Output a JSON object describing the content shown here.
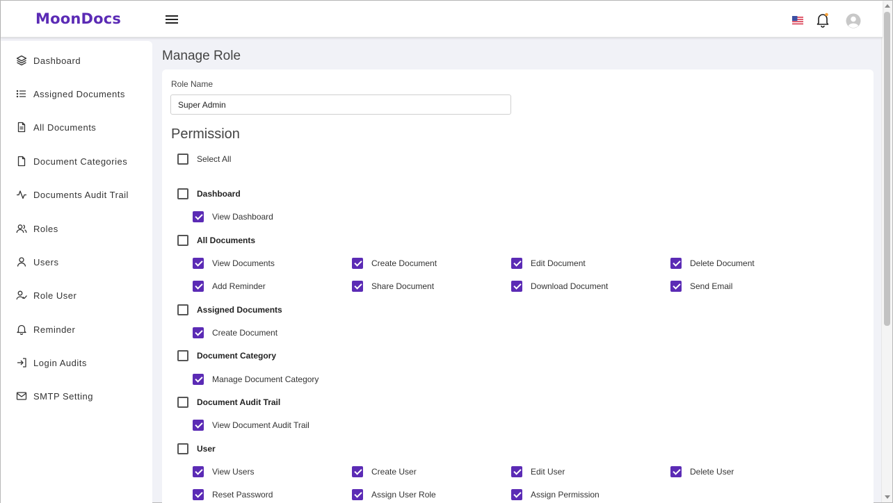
{
  "header": {
    "logo": "MoonDocs"
  },
  "sidebar": {
    "items": [
      {
        "label": "Dashboard",
        "icon": "layers-icon"
      },
      {
        "label": "Assigned Documents",
        "icon": "list-icon"
      },
      {
        "label": "All Documents",
        "icon": "file-text-icon"
      },
      {
        "label": "Document Categories",
        "icon": "file-icon"
      },
      {
        "label": "Documents Audit Trail",
        "icon": "activity-icon"
      },
      {
        "label": "Roles",
        "icon": "users-icon"
      },
      {
        "label": "Users",
        "icon": "user-icon"
      },
      {
        "label": "Role User",
        "icon": "user-check-icon"
      },
      {
        "label": "Reminder",
        "icon": "bell-icon"
      },
      {
        "label": "Login Audits",
        "icon": "log-in-icon"
      },
      {
        "label": "SMTP Setting",
        "icon": "mail-icon"
      }
    ]
  },
  "main": {
    "title": "Manage Role",
    "role_name_label": "Role Name",
    "role_name_value": "Super Admin",
    "permission_title": "Permission",
    "select_all": "Select All",
    "groups": [
      {
        "name": "Dashboard",
        "permissions": [
          "View Dashboard"
        ]
      },
      {
        "name": "All Documents",
        "permissions": [
          "View Documents",
          "Create Document",
          "Edit Document",
          "Delete Document",
          "Add Reminder",
          "Share Document",
          "Download Document",
          "Send Email"
        ]
      },
      {
        "name": "Assigned Documents",
        "permissions": [
          "Create Document"
        ]
      },
      {
        "name": "Document Category",
        "permissions": [
          "Manage Document Category"
        ]
      },
      {
        "name": "Document Audit Trail",
        "permissions": [
          "View Document Audit Trail"
        ]
      },
      {
        "name": "User",
        "permissions": [
          "View Users",
          "Create User",
          "Edit User",
          "Delete User",
          "Reset Password",
          "Assign User Role",
          "Assign Permission"
        ]
      }
    ]
  },
  "colors": {
    "accent": "#5b2bb5"
  }
}
